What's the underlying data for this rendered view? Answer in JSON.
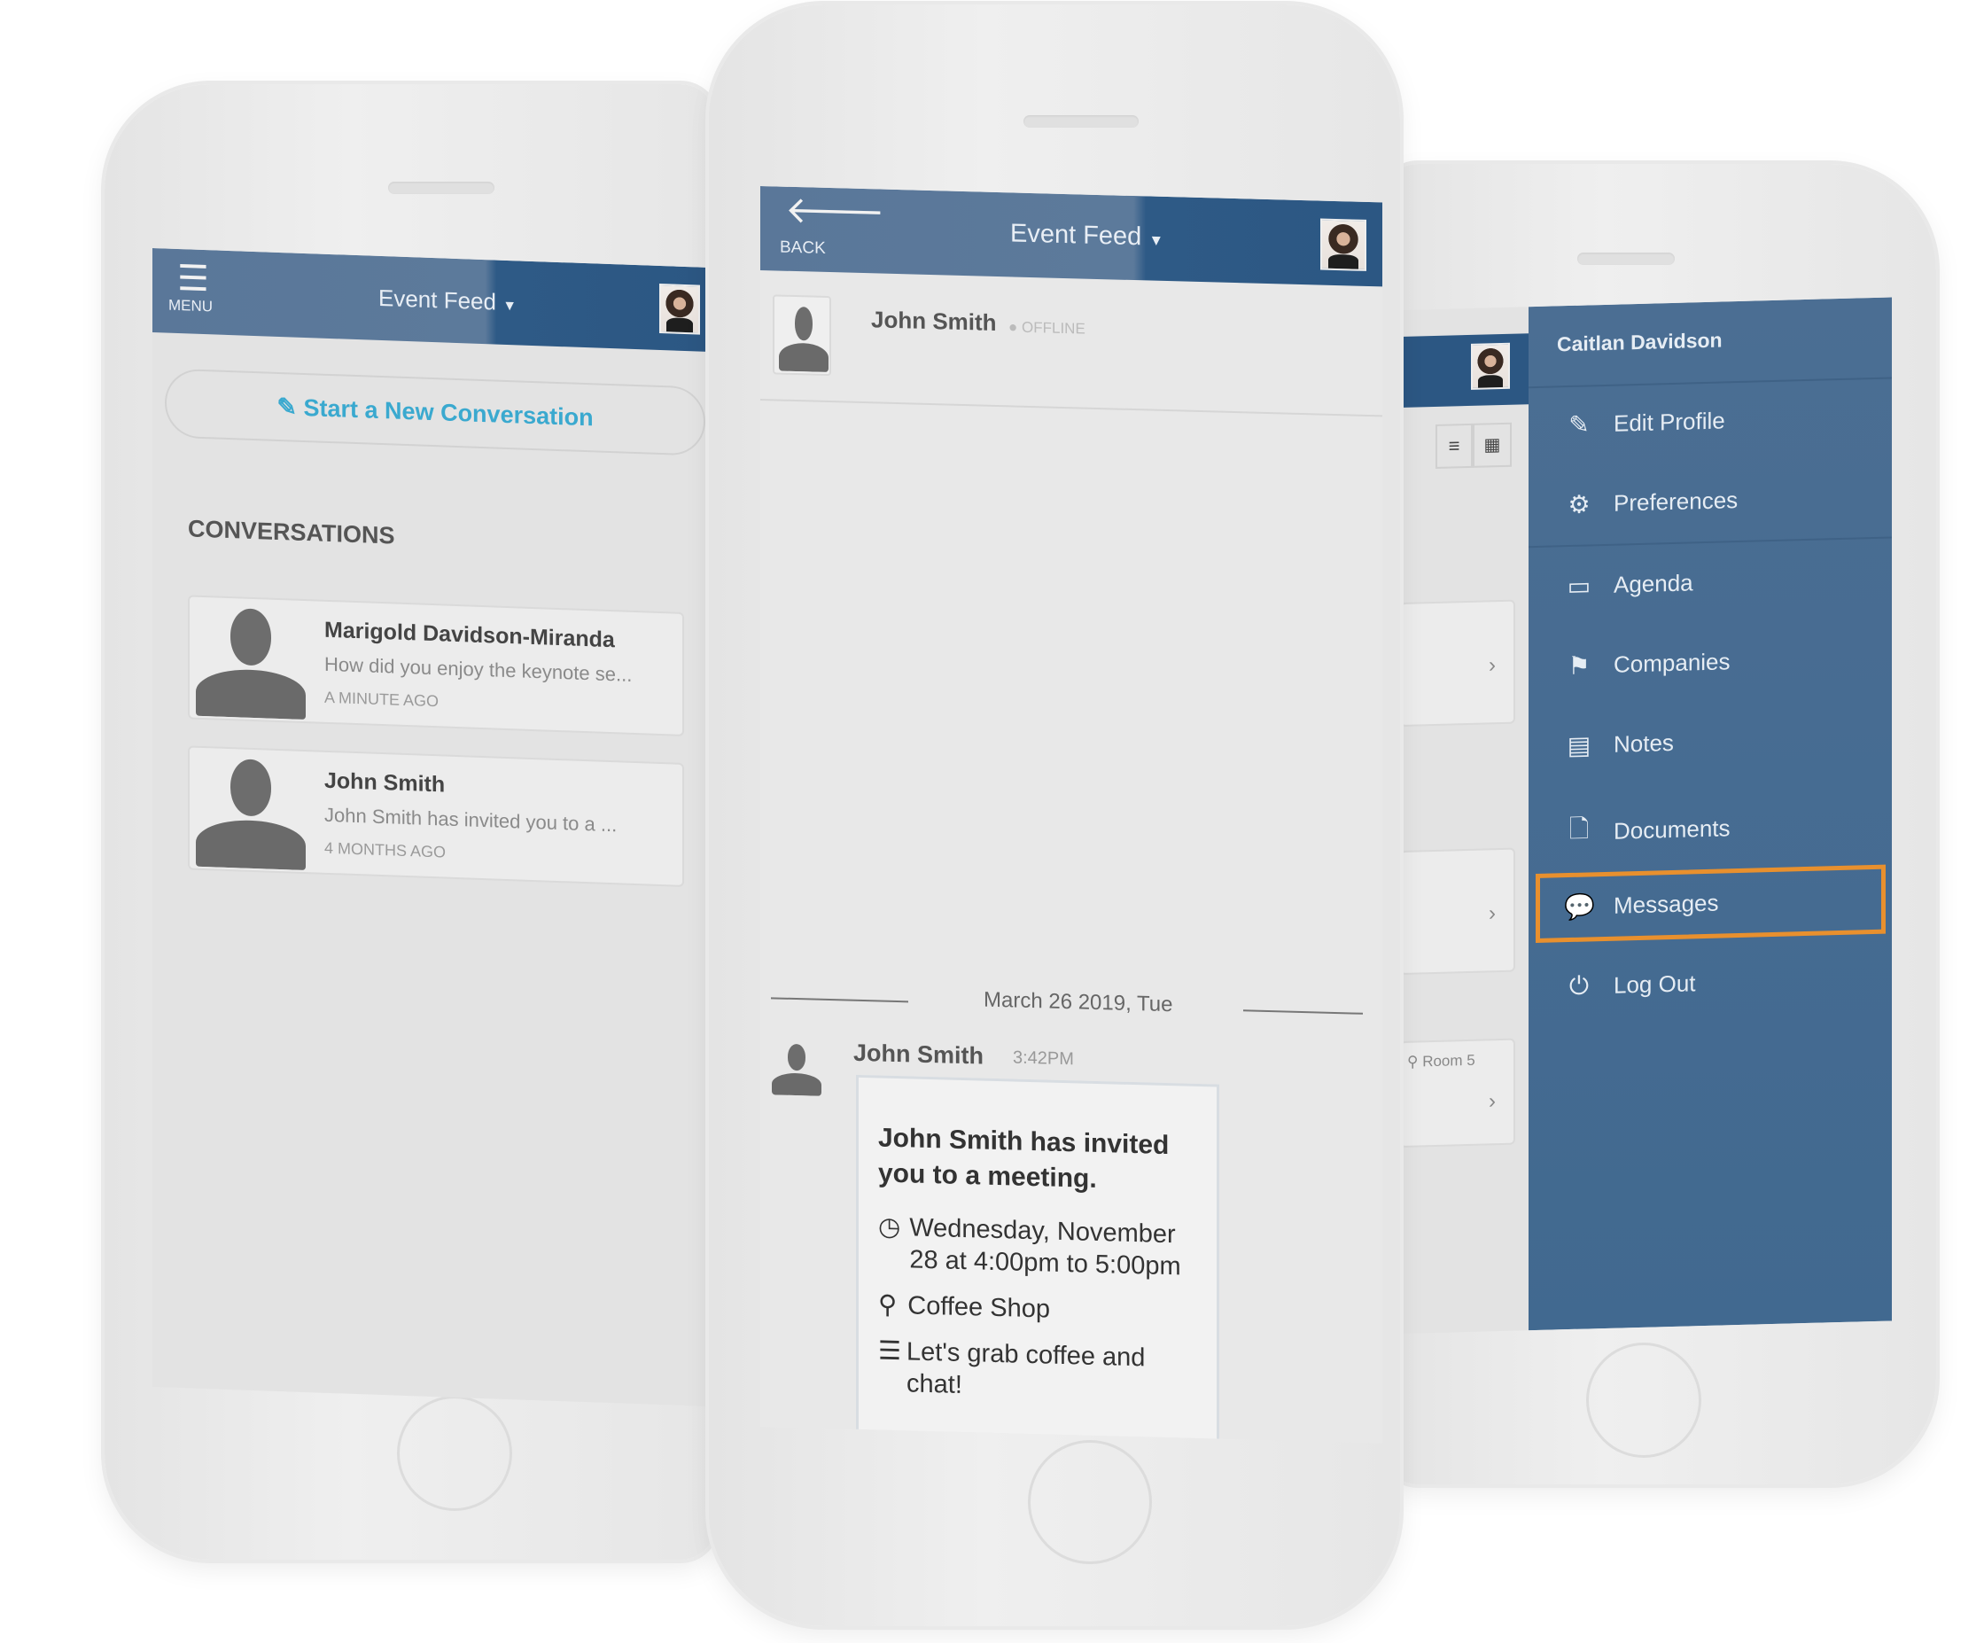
{
  "left_phone": {
    "header": {
      "menu_label": "MENU",
      "title": "Event Feed",
      "dropdown_icon": "caret-down-icon"
    },
    "new_conversation_label": "Start a New Conversation",
    "section_title": "CONVERSATIONS",
    "conversations": [
      {
        "name": "Marigold Davidson-Miranda",
        "preview": "How did you enjoy the keynote se...",
        "time": "A MINUTE AGO"
      },
      {
        "name": "John Smith",
        "preview": "John Smith has invited you to a ...",
        "time": "4 MONTHS AGO"
      }
    ]
  },
  "center_phone": {
    "header": {
      "back_label": "BACK",
      "title": "Event Feed"
    },
    "contact": {
      "name": "John Smith",
      "status": "OFFLINE"
    },
    "date_divider": "March 26 2019, Tue",
    "message": {
      "sender": "John Smith",
      "time": "3:42PM",
      "title": "John Smith has invited you to a meeting.",
      "when": "Wednesday, November 28 at 4:00pm to 5:00pm",
      "where": "Coffee Shop",
      "note": "Let's grab coffee and chat!"
    }
  },
  "right_phone": {
    "background_list": {
      "room_label": "Room 5"
    },
    "drawer": {
      "user_name": "Caitlan Davidson",
      "items": [
        {
          "label": "Edit Profile",
          "icon": "edit-icon"
        },
        {
          "label": "Preferences",
          "icon": "gear-icon"
        },
        {
          "label": "Agenda",
          "icon": "calendar-icon"
        },
        {
          "label": "Companies",
          "icon": "flag-icon"
        },
        {
          "label": "Notes",
          "icon": "note-icon"
        },
        {
          "label": "Documents",
          "icon": "document-icon"
        },
        {
          "label": "Messages",
          "icon": "chat-bubble-icon",
          "highlighted": true
        },
        {
          "label": "Log Out",
          "icon": "power-icon"
        }
      ]
    }
  },
  "colors": {
    "header_blue": "#5a7799",
    "drawer_blue": "#456a91",
    "accent_teal": "#3aa9cf",
    "highlight_orange": "#e8902e"
  }
}
